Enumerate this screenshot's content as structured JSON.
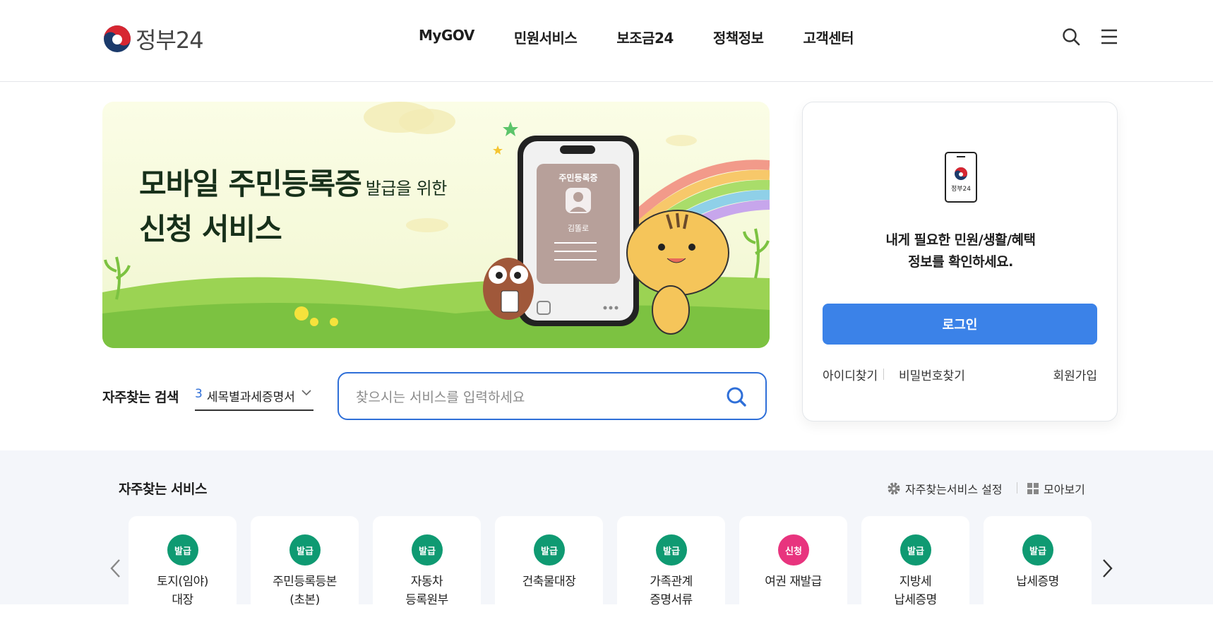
{
  "header": {
    "logo_text": "정부24",
    "nav": [
      "MyGOV",
      "민원서비스",
      "보조금24",
      "정책정보",
      "고객센터"
    ]
  },
  "banner": {
    "line1": "모바일 주민등록증",
    "line1_small": "발급을 위한",
    "line2": "신청 서비스",
    "card_title": "주민등록증",
    "card_name": "김똘로"
  },
  "quick_search": {
    "label": "자주찾는 검색",
    "rank": "3",
    "keyword": "세목별과세증명서",
    "placeholder": "찾으시는 서비스를 입력하세요"
  },
  "login": {
    "icon_text": "정부24",
    "message_line1": "내게 필요한 민원/생활/혜택",
    "message_line2": "정보를 확인하세요.",
    "button": "로그인",
    "find_id": "아이디찾기",
    "find_pw": "비밀번호찾기",
    "signup": "회원가입"
  },
  "services": {
    "title": "자주찾는 서비스",
    "settings_label": "자주찾는서비스 설정",
    "viewall_label": "모아보기",
    "items": [
      {
        "badge": "발급",
        "line1": "토지(임야)",
        "line2": "대장",
        "color": "#0f9a72"
      },
      {
        "badge": "발급",
        "line1": "주민등록등본",
        "line2": "(초본)",
        "color": "#0f9a72"
      },
      {
        "badge": "발급",
        "line1": "자동차",
        "line2": "등록원부",
        "color": "#0f9a72"
      },
      {
        "badge": "발급",
        "line1": "건축물대장",
        "line2": "",
        "color": "#0f9a72"
      },
      {
        "badge": "발급",
        "line1": "가족관계",
        "line2": "증명서류",
        "color": "#0f9a72"
      },
      {
        "badge": "신청",
        "line1": "여권 재발급",
        "line2": "",
        "color": "#e8347e"
      },
      {
        "badge": "발급",
        "line1": "지방세",
        "line2": "납세증명",
        "color": "#0f9a72"
      },
      {
        "badge": "발급",
        "line1": "납세증명",
        "line2": "",
        "color": "#0f9a72"
      }
    ]
  },
  "colors": {
    "primary": "#3b82e8",
    "issue_badge": "#0f9a72",
    "apply_badge": "#e8347e",
    "search_border": "#2f6fd8"
  }
}
